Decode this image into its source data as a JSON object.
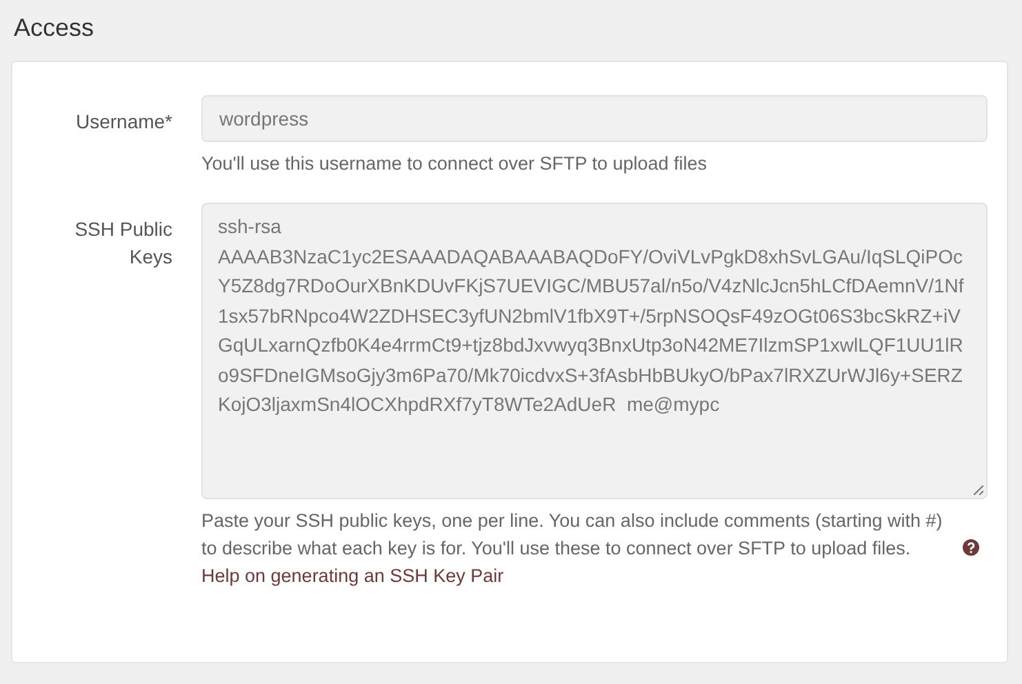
{
  "section_title": "Access",
  "fields": [
    {
      "kind": "input",
      "label": "Username*",
      "value": "wordpress",
      "help": "You'll use this username to connect over SFTP to upload files"
    },
    {
      "kind": "textarea",
      "label": "SSH Public Keys",
      "value": "ssh-rsa AAAAB3NzaC1yc2ESAAADAQABAAABAQDoFY/OviVLvPgkD8xhSvLGAu/IqSLQiPOcY5Z8dg7RDoOurXBnKDUvFKjS7UEVIGC/MBU57al/n5o/V4zNlcJcn5hLCfDAemnV/1Nf1sx57bRNpco4W2ZDHSEC3yfUN2bmlV1fbX9T+/5rpNSOQsF49zOGt06S3bcSkRZ+iVGqULxarnQzfb0K4e4rrmCt9+tjz8bdJxvwyq3BnxUtp3oN42ME7IlzmSP1xwlLQF1UU1lRo9SFDneIGMsoGjy3m6Pa70/Mk70icdvxS+3fAsbHbBUkyO/bPax7lRXZUrWJl6y+SERZKojO3ljaxmSn4lOCXhpdRXf7yT8WTe2AdUeR  me@mypc",
      "help": "Paste your SSH public keys, one per line. You can also include comments (starting with #) to describe what each key is for. You'll use these to connect over SFTP to upload files.",
      "help_link": "Help on generating an SSH Key Pair"
    }
  ]
}
